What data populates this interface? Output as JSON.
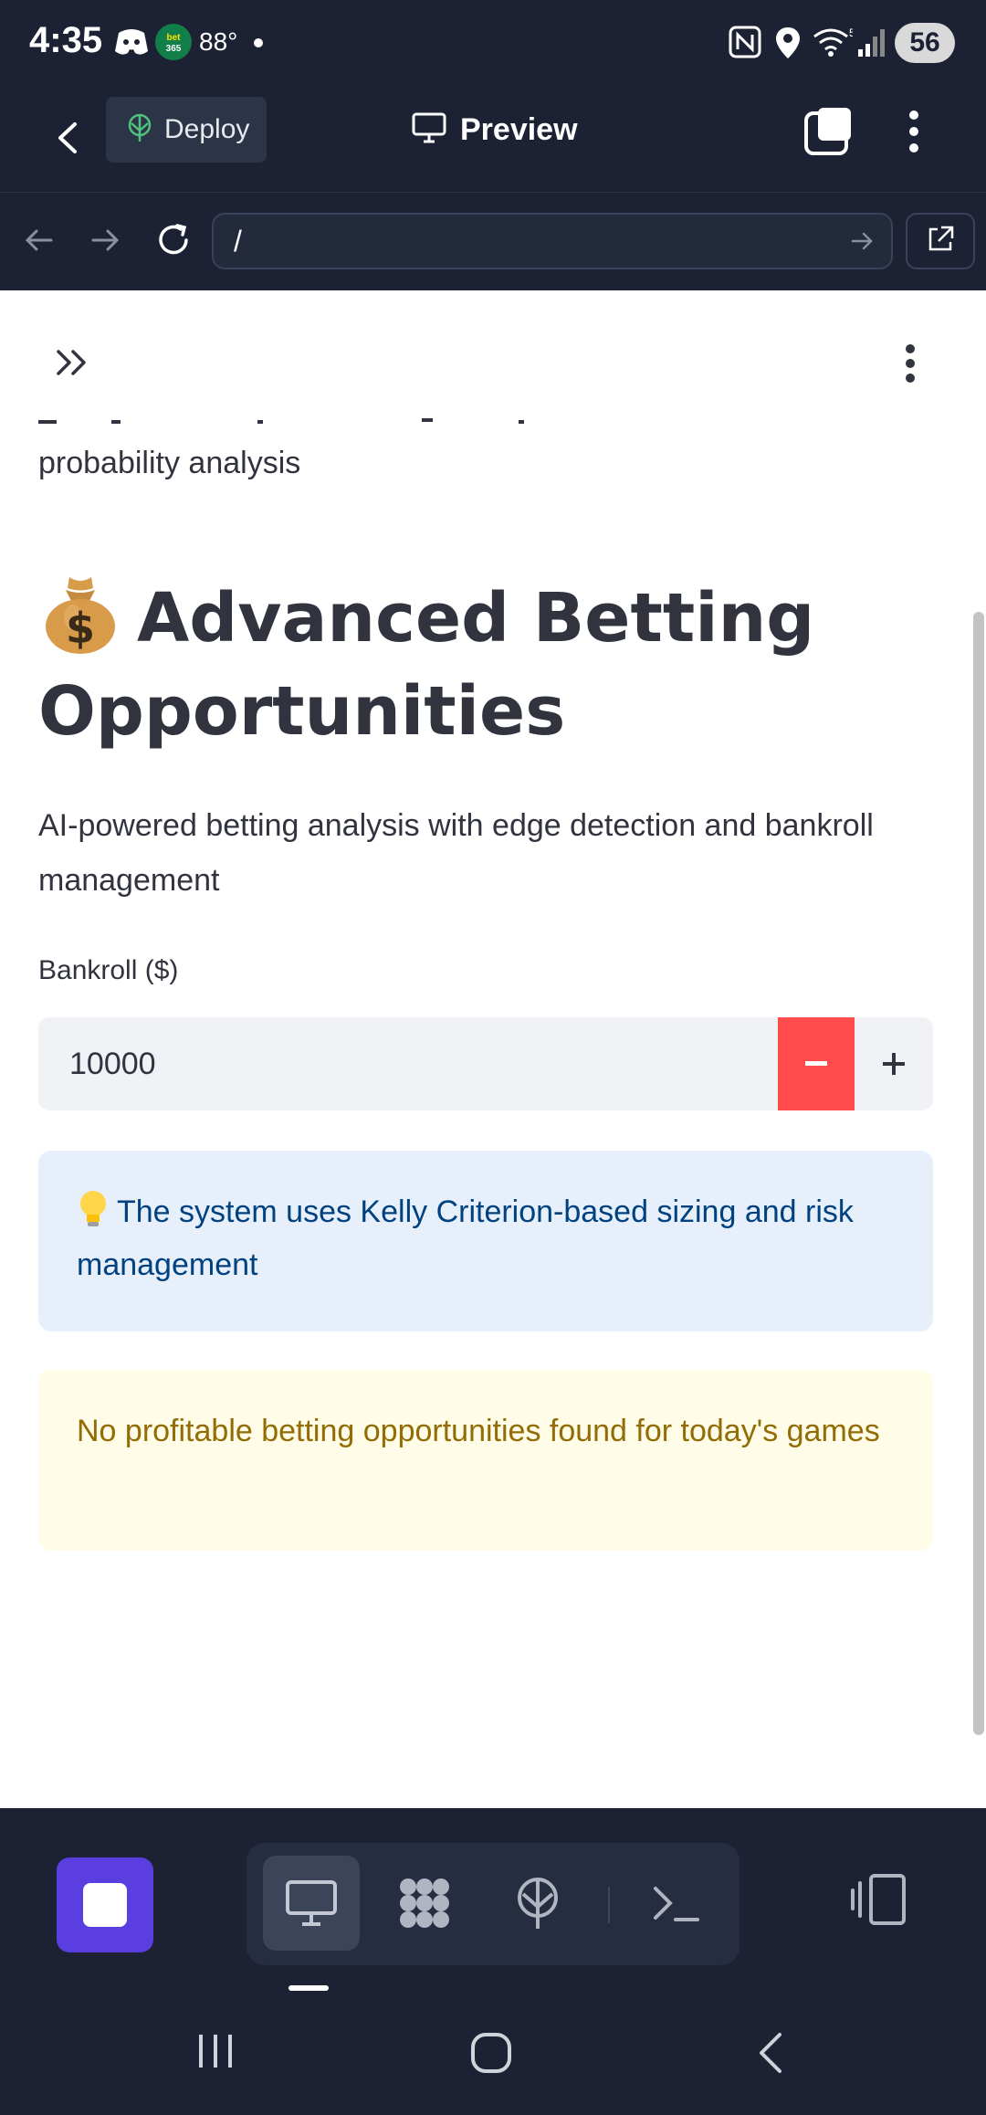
{
  "status_bar": {
    "time": "4:35",
    "temperature": "88°",
    "battery": "56",
    "icons": [
      "discord-icon",
      "bet365-icon",
      "nfc-icon",
      "location-icon",
      "wifi-icon",
      "signal-icon"
    ]
  },
  "app_header": {
    "deploy_label": "Deploy",
    "preview_label": "Preview"
  },
  "url_bar": {
    "value": "/"
  },
  "content": {
    "previous_text": "probability analysis",
    "heading": "Advanced Betting Opportunities",
    "heading_emoji": "money-bag",
    "subtitle": "AI-powered betting analysis with edge detection and bankroll management",
    "bankroll_label": "Bankroll ($)",
    "bankroll_value": "10000",
    "decrement_symbol": "−",
    "increment_symbol": "+",
    "info_message": "The system uses Kelly Criterion-based sizing and risk management",
    "warning_message": "No profitable betting opportunities found for today's games"
  },
  "colors": {
    "background_dark": "#1c2233",
    "accent_purple": "#5a3ee0",
    "decrement_red": "#ff4b4b",
    "info_bg": "#e7f0fa",
    "info_text": "#004280",
    "warning_bg": "#fffce7",
    "warning_text": "#926c05"
  }
}
